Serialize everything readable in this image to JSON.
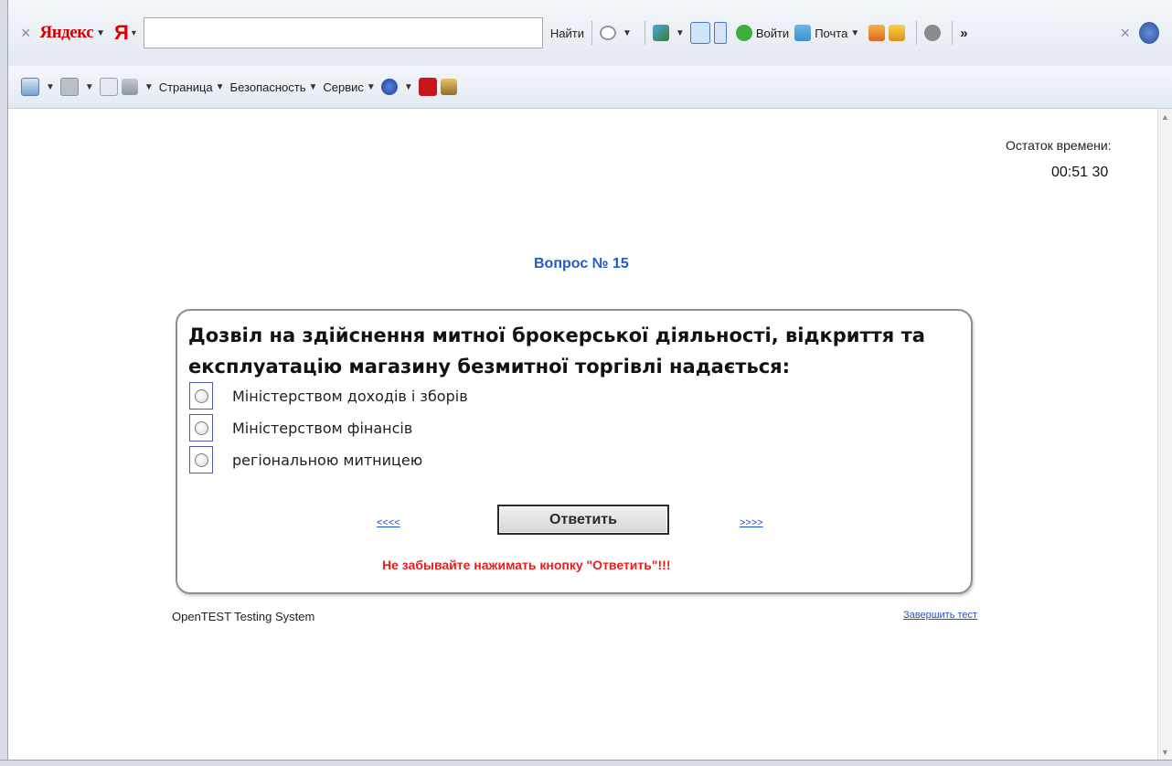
{
  "toolbar1": {
    "close": "×",
    "brand": "Яндекс",
    "ya_letter": "Я",
    "search_value": "",
    "find_label": "Найти",
    "login_label": "Войти",
    "mail_label": "Почта",
    "more": "»",
    "close_right": "×"
  },
  "toolbar2": {
    "page_menu": "Страница",
    "security_menu": "Безопасность",
    "service_menu": "Сервис"
  },
  "timer": {
    "label": "Остаток времени:",
    "value": "00:51 30"
  },
  "question": {
    "number_label": "Вопрос № 15",
    "text": "Дозвіл на здійснення митної брокерської діяльності, відкриття та експлуатацію магазину безмитної торгівлі надається:",
    "options": [
      "Міністерством доходів і зборів",
      "Міністерством фінансів",
      "регіональною митницею"
    ]
  },
  "nav": {
    "prev": "<<<<",
    "next": ">>>>",
    "answer_button": "Ответить",
    "warning": "Не забывайте нажимать кнопку \"Ответить\"!!!"
  },
  "footer": {
    "system_name": "OpenTEST Testing System",
    "finish_link": "Завершить тест"
  },
  "colors": {
    "question_number": "#1f5bc9",
    "warning": "#ea1c1c",
    "link": "#1a4fd0",
    "brand": "#d40000"
  }
}
